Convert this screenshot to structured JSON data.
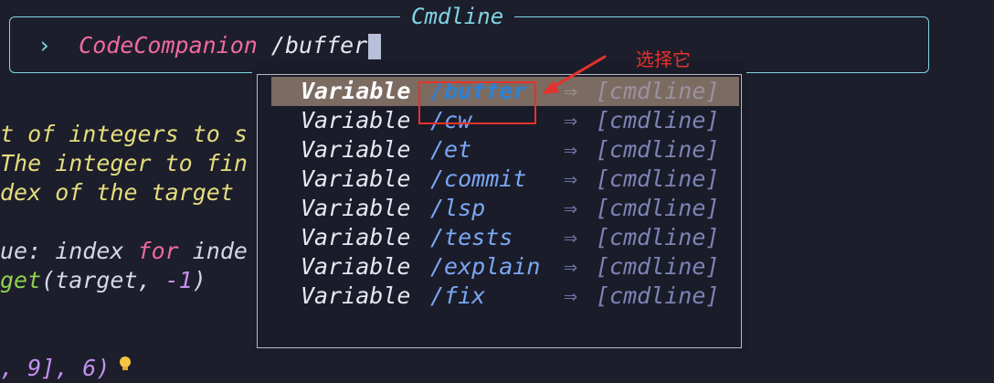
{
  "editor": {
    "lines": [
      [
        {
          "t": "t of integers to s",
          "c": "c-yellow"
        }
      ],
      [
        {
          "t": "The integer to fin",
          "c": "c-yellow"
        }
      ],
      [
        {
          "t": "dex of the target",
          "c": "c-yellow"
        }
      ],
      [],
      [
        {
          "t": "ue: index ",
          "c": "c-white"
        },
        {
          "t": "for",
          "c": "c-pink"
        },
        {
          "t": " inde",
          "c": "c-white"
        }
      ],
      [
        {
          "t": "get",
          "c": "c-green"
        },
        {
          "t": "(target, ",
          "c": "c-white"
        },
        {
          "t": "-1",
          "c": "c-purple"
        },
        {
          "t": ")",
          "c": "c-white"
        }
      ],
      [],
      [],
      [
        {
          "t": ", 9], 6)",
          "c": "c-purple"
        }
      ]
    ]
  },
  "cmdline": {
    "title": "Cmdline",
    "chevron": "›",
    "command": "CodeCompanion",
    "argument": " /buffer"
  },
  "completion": {
    "items": [
      {
        "kind": "Variable",
        "word": "/buffer",
        "arrow": "⇒",
        "menu": "[cmdline]",
        "selected": true
      },
      {
        "kind": "Variable",
        "word": "/cw",
        "arrow": "⇒",
        "menu": "[cmdline]",
        "selected": false
      },
      {
        "kind": "Variable",
        "word": "/et",
        "arrow": "⇒",
        "menu": "[cmdline]",
        "selected": false
      },
      {
        "kind": "Variable",
        "word": "/commit",
        "arrow": "⇒",
        "menu": "[cmdline]",
        "selected": false
      },
      {
        "kind": "Variable",
        "word": "/lsp",
        "arrow": "⇒",
        "menu": "[cmdline]",
        "selected": false
      },
      {
        "kind": "Variable",
        "word": "/tests",
        "arrow": "⇒",
        "menu": "[cmdline]",
        "selected": false
      },
      {
        "kind": "Variable",
        "word": "/explain",
        "arrow": "⇒",
        "menu": "[cmdline]",
        "selected": false
      },
      {
        "kind": "Variable",
        "word": "/fix",
        "arrow": "⇒",
        "menu": "[cmdline]",
        "selected": false
      }
    ]
  },
  "annotation": {
    "label": "选择它",
    "color": "#e5322d"
  },
  "icons": {
    "lightbulb": "lightbulb-icon"
  }
}
